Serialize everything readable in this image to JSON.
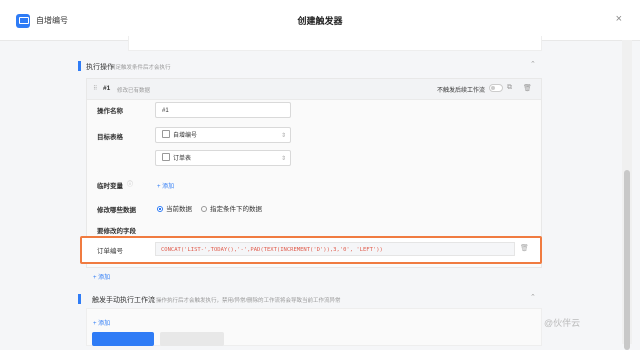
{
  "window": {
    "app_name": "自增编号",
    "dialog_title": "创建触发器",
    "close_glyph": "×"
  },
  "execute_section": {
    "title": "执行操作",
    "description": "满足触发条件后才会执行",
    "chevron": "⌃"
  },
  "action": {
    "index_label": "#1",
    "subtitle": "修改已有数据",
    "toggle_label": "不触发后续工作流",
    "name_label": "操作名称",
    "name_value": "#1",
    "target_label": "目标表格",
    "target_app": "自增编号",
    "target_table": "订单表",
    "temp_var_label": "临时变量",
    "add_label": "+ 添加",
    "modify_which_label": "修改哪些数据",
    "radio_current": "当前数据",
    "radio_condition": "指定条件下的数据",
    "fields_label": "要修改的字段",
    "field_name": "订单编号",
    "formula": "CONCAT('LIST-',TODAY(),'-',PAD(TEXT(INCREMENT('D')),3,'0', 'LEFT'))"
  },
  "add_action_label": "+ 添加",
  "manual_section": {
    "title": "触发手动执行工作流",
    "description": "操作执行后才会触发执行，禁用/异常/删除的工作流将会导致当前工作流异常",
    "chevron": "⌃"
  },
  "partial_link": "+ 添加",
  "watermark": "@伙伴云",
  "colors": {
    "accent": "#2f7cf6",
    "highlight": "#f07b40",
    "formula_text": "#e05a4a"
  }
}
